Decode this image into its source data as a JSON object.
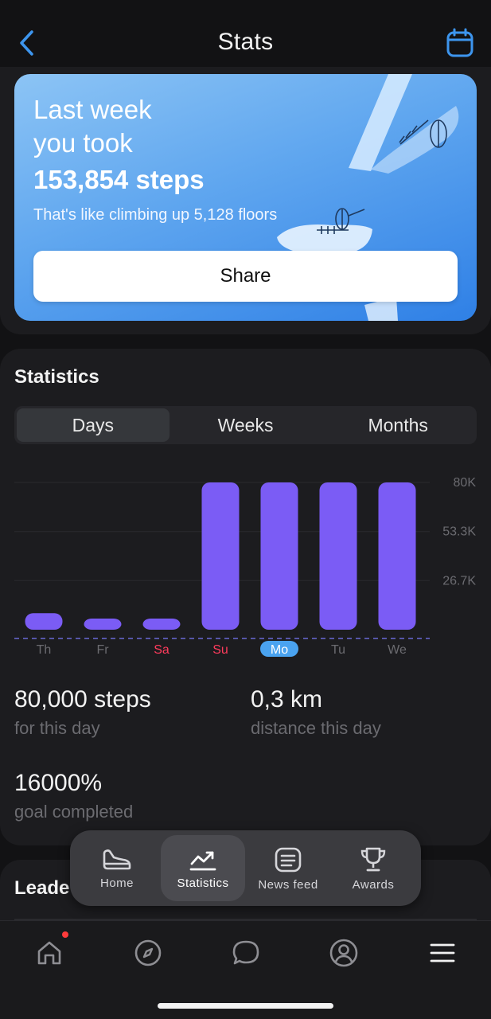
{
  "header": {
    "title": "Stats",
    "back_icon": "chevron-left-icon",
    "calendar_icon": "calendar-icon",
    "accent": "#3d95ee"
  },
  "hero": {
    "line1": "Last week",
    "line2": "you took",
    "steps": "153,854 steps",
    "subtitle": "That's like climbing up 5,128 floors",
    "share_label": "Share"
  },
  "statistics": {
    "title": "Statistics",
    "tabs": [
      {
        "label": "Days",
        "active": true
      },
      {
        "label": "Weeks",
        "active": false
      },
      {
        "label": "Months",
        "active": false
      }
    ]
  },
  "chart_data": {
    "type": "bar",
    "categories": [
      "Th",
      "Fr",
      "Sa",
      "Su",
      "Mo",
      "Tu",
      "We"
    ],
    "values": [
      9000,
      4000,
      2500,
      80000,
      80000,
      80000,
      80000
    ],
    "ylim": [
      0,
      80000
    ],
    "y_ticks": [
      "80K",
      "53.3K",
      "26.7K"
    ],
    "y_tick_values": [
      80000,
      53300,
      26700
    ],
    "weekend_categories": [
      "Sa",
      "Su"
    ],
    "selected_category": "Mo",
    "bar_color": "#7b5cf5",
    "weekend_label_color": "#ff3b5c",
    "selected_label_bg": "#4aa3f0",
    "goal_line": "dashed"
  },
  "metrics": {
    "steps_value": "80,000 steps",
    "steps_label": "for this day",
    "distance_value": "0,3 km",
    "distance_label": "distance this day",
    "goal_value": "16000%",
    "goal_label": "goal completed"
  },
  "leaderboard": {
    "title": "Leade"
  },
  "floating_tabs": [
    {
      "label": "Home",
      "icon": "shoe-icon",
      "active": false
    },
    {
      "label": "Statistics",
      "icon": "trend-chart-icon",
      "active": true
    },
    {
      "label": "News feed",
      "icon": "newspaper-icon",
      "active": false
    },
    {
      "label": "Awards",
      "icon": "trophy-icon",
      "active": false
    }
  ],
  "bottom_nav": [
    {
      "icon": "home-icon",
      "badge": true
    },
    {
      "icon": "compass-icon",
      "badge": false
    },
    {
      "icon": "chat-bubble-icon",
      "badge": false
    },
    {
      "icon": "profile-icon",
      "badge": false
    },
    {
      "icon": "menu-icon",
      "badge": false
    }
  ]
}
